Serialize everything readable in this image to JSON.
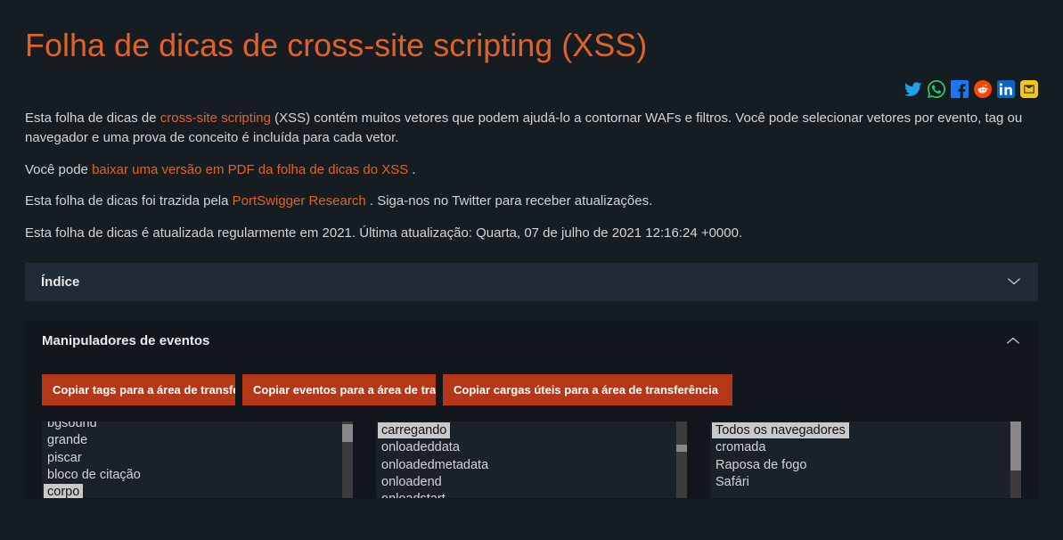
{
  "title": "Folha de dicas de cross-site scripting (XSS)",
  "share": {
    "twitter": "twitter-icon",
    "whatsapp": "whatsapp-icon",
    "facebook": "facebook-icon",
    "reddit": "reddit-icon",
    "linkedin": "linkedin-icon",
    "email": "email-icon"
  },
  "intro": {
    "p1a": "Esta folha de dicas de ",
    "p1link": "cross-site scripting",
    "p1b": " (XSS) contém muitos vetores que podem ajudá-lo a contornar WAFs e filtros. Você pode selecionar vetores por evento, tag ou navegador e uma prova de conceito é incluída para cada vetor.",
    "p2a": "Você pode ",
    "p2link": "baixar uma versão em PDF da folha de dicas do XSS",
    "p2b": " .",
    "p3a": "Esta folha de dicas foi trazida pela ",
    "p3link": "PortSwigger Research",
    "p3b": " . Siga-nos no Twitter para receber atualizações.",
    "p4": "Esta folha de dicas é atualizada regularmente em 2021. Última atualização: Quarta, 07 de julho de 2021 12:16:24 +0000."
  },
  "index_label": "Índice",
  "handlers_label": "Manipuladores de eventos",
  "buttons": {
    "copy_tags": "Copiar tags para a área de transferência",
    "copy_events": "Copiar eventos para a área de transferência",
    "copy_payloads": "Copiar cargas úteis para a área de transferência"
  },
  "tags_list": [
    "bgsound",
    "grande",
    "piscar",
    "bloco de citação",
    "corpo"
  ],
  "tags_selected": "corpo",
  "events_list": [
    "carregando",
    "onloadeddata",
    "onloadedmetadata",
    "onloadend",
    "onloadstart"
  ],
  "events_selected": "carregando",
  "browsers_list": [
    "Todos os navegadores",
    "cromada",
    "Raposa de fogo",
    "Safári"
  ],
  "browsers_selected": "Todos os navegadores"
}
